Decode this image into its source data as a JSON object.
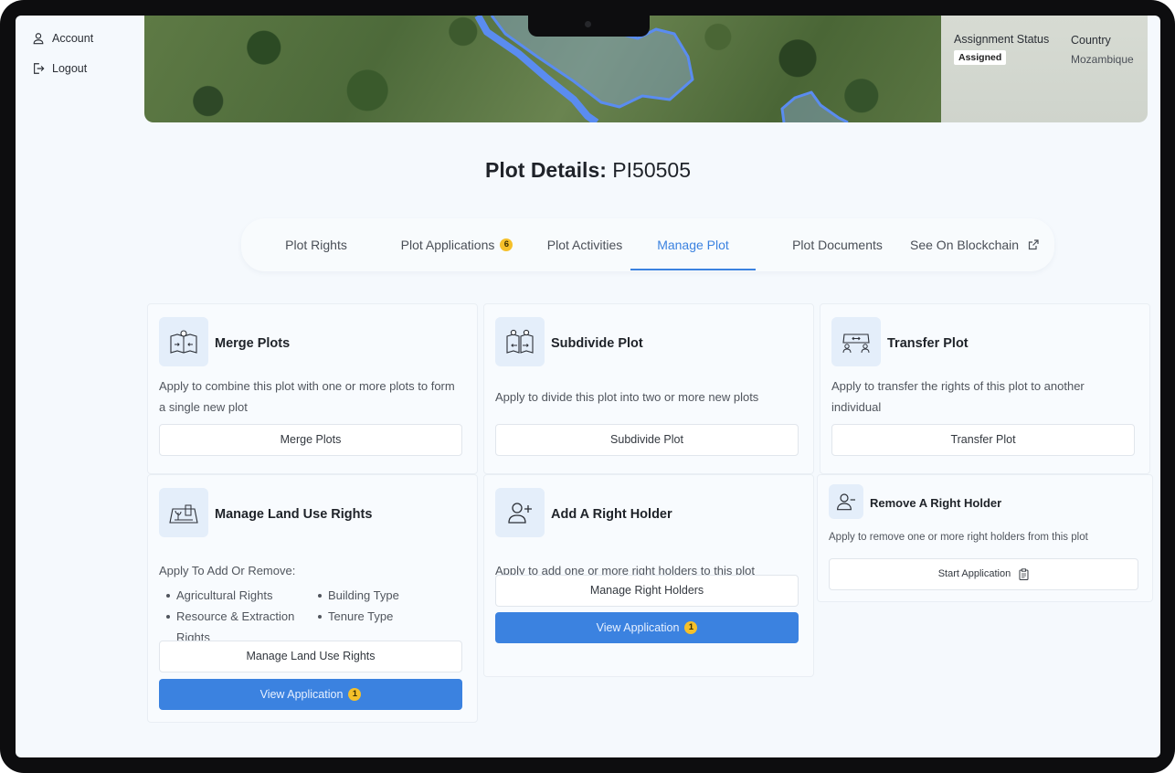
{
  "sidebar": {
    "items": [
      {
        "label": "Account",
        "icon": "user-icon"
      },
      {
        "label": "Logout",
        "icon": "logout-icon"
      }
    ]
  },
  "hero": {
    "assignment_status_label": "Assignment Status",
    "assignment_status_value": "Assigned",
    "country_label": "Country",
    "country_value": "Mozambique"
  },
  "page": {
    "title_prefix": "Plot Details:",
    "plot_id": "PI50505"
  },
  "tabs": [
    {
      "label": "Plot Rights"
    },
    {
      "label": "Plot Applications",
      "count": "6"
    },
    {
      "label": "Plot Activities"
    },
    {
      "label": "Manage Plot",
      "active": true
    },
    {
      "label": "Plot Documents"
    },
    {
      "label": "See On Blockchain",
      "icon": "external-link-icon"
    }
  ],
  "cards": {
    "merge": {
      "title": "Merge Plots",
      "desc": "Apply to combine this plot with one or more plots to form a single new plot",
      "button": "Merge Plots",
      "icon": "merge-plots-icon"
    },
    "subdivide": {
      "title": "Subdivide Plot",
      "desc": "Apply to divide this plot into two or more new plots",
      "button": "Subdivide Plot",
      "icon": "subdivide-plot-icon"
    },
    "transfer": {
      "title": "Transfer Plot",
      "desc": "Apply to transfer the rights of this plot to another individual",
      "button": "Transfer Plot",
      "icon": "transfer-plot-icon"
    },
    "land_use": {
      "title": "Manage Land Use Rights",
      "intro": "Apply To Add Or Remove:",
      "rights": [
        "Agricultural Rights",
        "Building Type",
        "Resource & Extraction Rights",
        "Tenure Type"
      ],
      "button": "Manage Land Use Rights",
      "view_button": "View Application",
      "view_count": "1",
      "icon": "land-use-icon"
    },
    "add_holder": {
      "title": "Add A Right Holder",
      "desc": "Apply to add one or more right holders to this plot",
      "button": "Manage Right Holders",
      "view_button": "View Application",
      "view_count": "1",
      "icon": "add-user-icon"
    },
    "remove_holder": {
      "title": "Remove A Right Holder",
      "desc": "Apply to remove one or more right holders from this plot",
      "button": "Start Application",
      "icon": "remove-user-icon"
    }
  },
  "colors": {
    "accent": "#3b82e0",
    "badge": "#f5c02a",
    "background": "#f5f9fd"
  }
}
